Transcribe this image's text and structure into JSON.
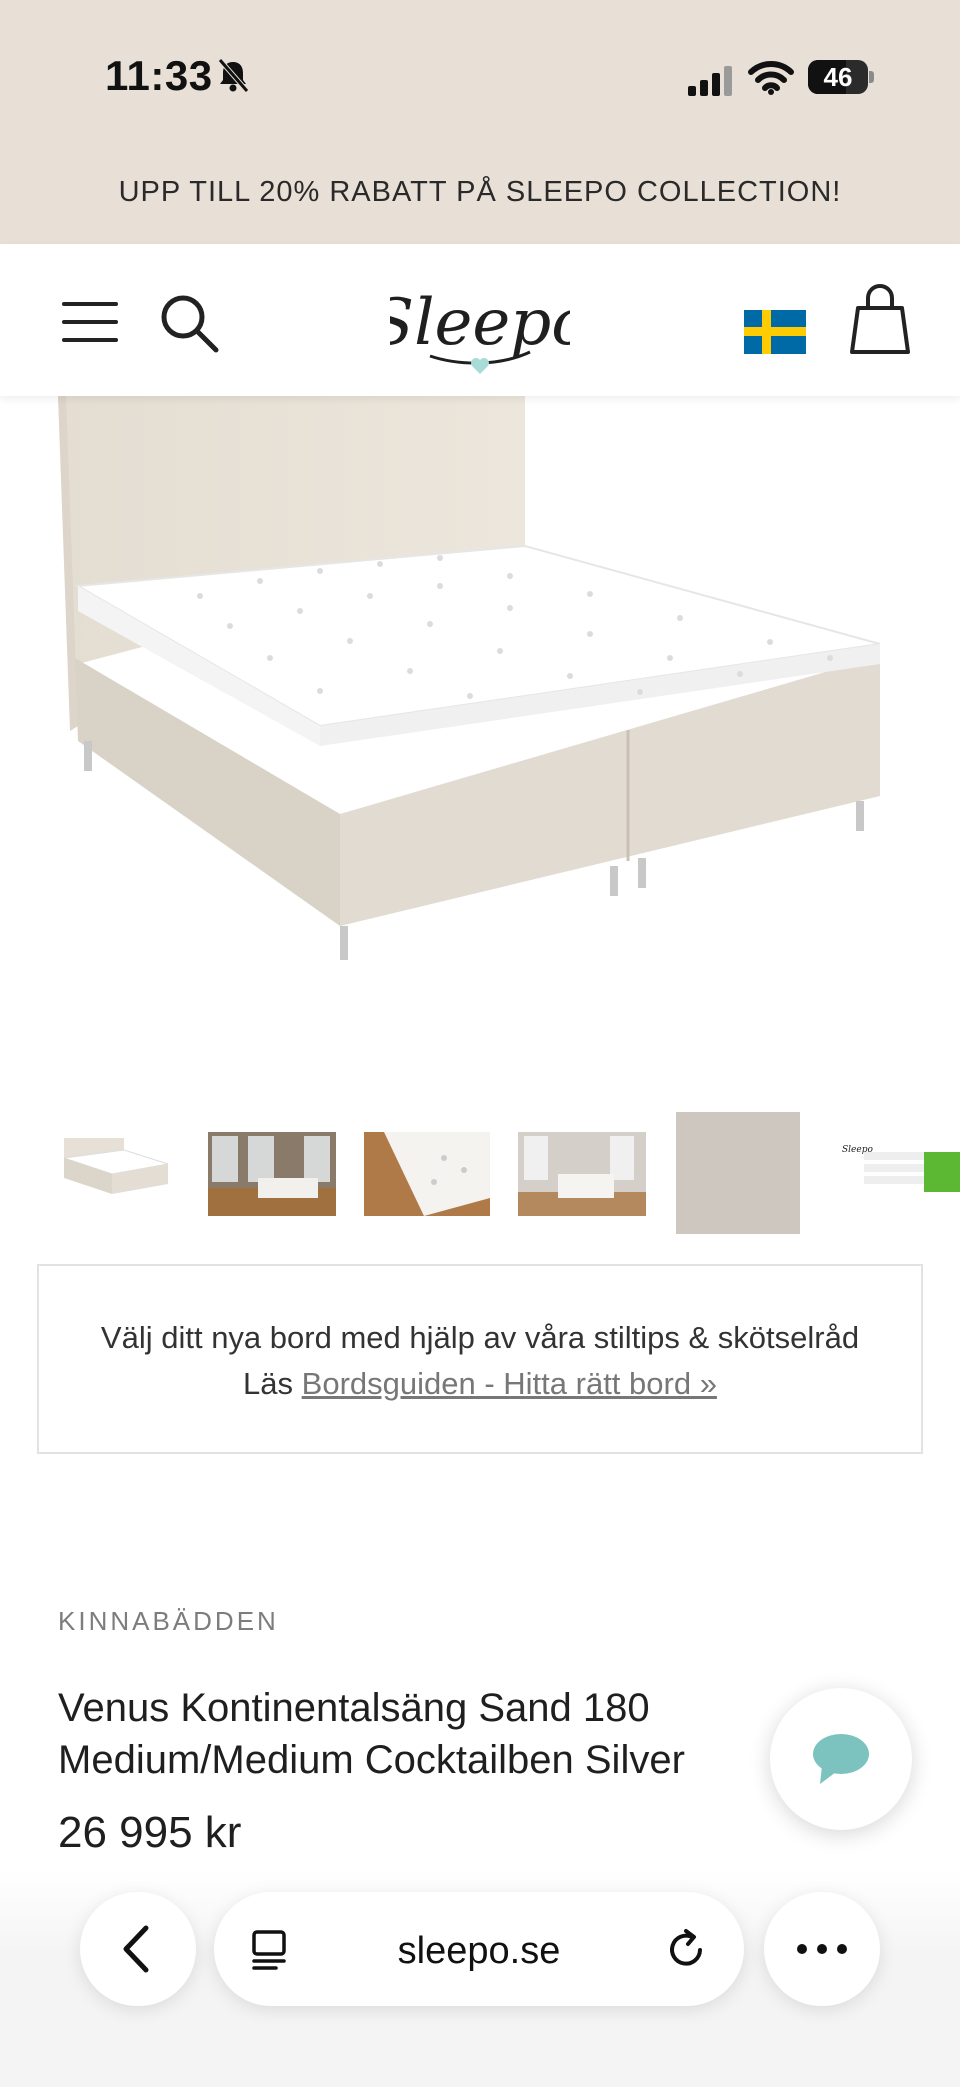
{
  "status_bar": {
    "time": "11:33",
    "battery": "46"
  },
  "promo": {
    "text": "UPP TILL 20% RABATT PÅ SLEEPO COLLECTION!"
  },
  "header": {
    "logo_text": "Sleepo"
  },
  "guide": {
    "line1": "Välj ditt nya bord med hjälp av våra stiltips & skötselråd",
    "prefix": "Läs",
    "link": "Bordsguiden - Hitta rätt bord »"
  },
  "product": {
    "brand": "KINNABÄDDEN",
    "title": "Venus Kontinentalsäng Sand 180 Medium/Medium Cocktailben Silver",
    "price": "26 995 kr"
  },
  "browser": {
    "url": "sleepo.se"
  },
  "colors": {
    "header_bg": "#e8e0d6",
    "accent": "#a8dcd8",
    "flag_blue": "#006aa7",
    "flag_yellow": "#fecc00",
    "chart_green": "#5cb833"
  }
}
